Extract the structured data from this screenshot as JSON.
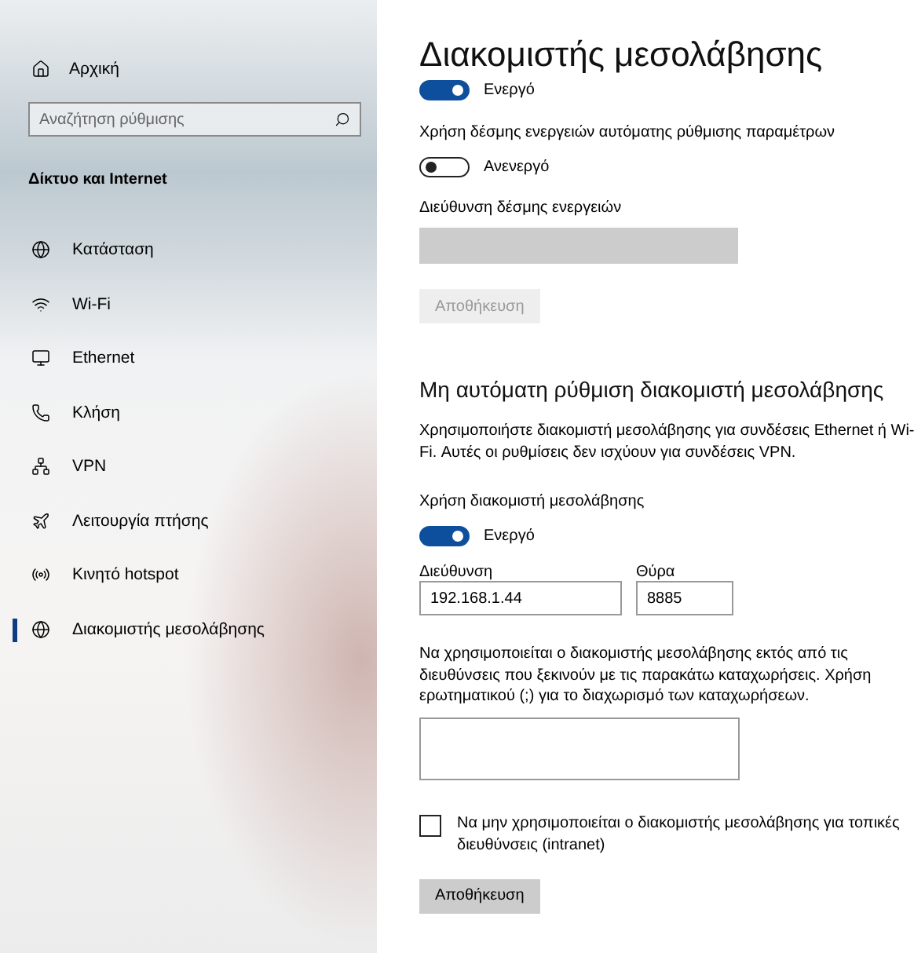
{
  "sidebar": {
    "home": "Αρχική",
    "search": {
      "placeholder": "Αναζήτηση ρύθμισης"
    },
    "heading": "Δίκτυο και Internet",
    "items": [
      {
        "label": "Κατάσταση",
        "selected": false
      },
      {
        "label": "Wi-Fi",
        "selected": false
      },
      {
        "label": "Ethernet",
        "selected": false
      },
      {
        "label": "Κλήση",
        "selected": false
      },
      {
        "label": "VPN",
        "selected": false
      },
      {
        "label": "Λειτουργία πτήσης",
        "selected": false
      },
      {
        "label": "Κινητό hotspot",
        "selected": false
      },
      {
        "label": "Διακομιστής μεσολάβησης",
        "selected": true
      }
    ]
  },
  "page": {
    "title": "Διακομιστής μεσολάβησης",
    "auto": {
      "detect_toggle": {
        "on": true,
        "label": "Ενεργό"
      },
      "script_label": "Χρήση δέσμης ενεργειών αυτόματης ρύθμισης παραμέτρων",
      "script_toggle": {
        "on": false,
        "label": "Ανενεργό"
      },
      "address_label": "Διεύθυνση δέσμης ενεργειών",
      "address_field": {
        "disabled": true
      },
      "save": {
        "label": "Αποθήκευση",
        "disabled": true
      }
    },
    "manual": {
      "heading": "Μη αυτόματη ρύθμιση διακομιστή μεσολάβησης",
      "description": "Χρησιμοποιήστε διακομιστή μεσολάβησης για συνδέσεις Ethernet ή Wi-Fi. Αυτές οι ρυθμίσεις δεν ισχύουν για συνδέσεις VPN.",
      "use_label": "Χρήση διακομιστή μεσολάβησης",
      "use_toggle": {
        "on": true,
        "label": "Ενεργό"
      },
      "address": {
        "label": "Διεύθυνση",
        "value": "192.168.1.44"
      },
      "port": {
        "label": "Θύρα",
        "value": "8885"
      },
      "exceptions_text": "Να χρησιμοποιείται ο διακομιστής μεσολάβησης εκτός από τις διευθύνσεις που ξεκινούν με τις παρακάτω καταχωρήσεις. Χρήση ερωτηματικού (;) για το διαχωρισμό των καταχωρήσεων.",
      "local_checkbox": {
        "checked": false,
        "label": "Να μην χρησιμοποιείται ο διακομιστής μεσολάβησης για τοπικές διευθύνσεις (intranet)"
      },
      "save": {
        "label": "Αποθήκευση",
        "disabled": false
      }
    }
  }
}
